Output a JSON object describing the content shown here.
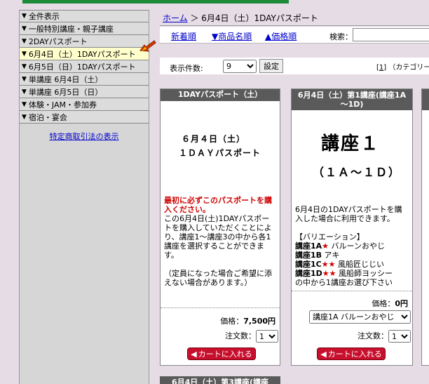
{
  "sidebar": {
    "categories": [
      {
        "label": "全件表示"
      },
      {
        "label": "一般特別講座・親子講座"
      },
      {
        "label": "2DAYパスポート"
      },
      {
        "label": "6月4日（土）1DAYパスポート"
      },
      {
        "label": "6月5日（日）1DAYパスポート"
      },
      {
        "label": "単講座 6月4日（土）"
      },
      {
        "label": "単講座 6月5日（日）"
      },
      {
        "label": "体験・JAM・参加券"
      },
      {
        "label": "宿泊・宴会"
      }
    ],
    "tokutei_link": "特定商取引法の表示"
  },
  "breadcrumb": {
    "home": "ホーム",
    "sep": " ＞ ",
    "current": "6月4日（土）1DAYパスポート"
  },
  "sortbar": {
    "newest": "新着順",
    "name": "▼商品名順",
    "price": "▲価格順",
    "search_label": "検索：",
    "search_value": ""
  },
  "countbar": {
    "label": "表示件数:",
    "selected": "9",
    "set_button": "設定",
    "page_num": "1",
    "page_text": "（カテゴリー内の"
  },
  "products": [
    {
      "header": "1DAYパスポート（土）",
      "image_line1": "６月４日（土）",
      "image_line2": "１ＤＡＹパスポート",
      "desc_red": "最初に必ずこのパスポートを購入ください。",
      "desc": "この6月4日(土)1DAYパスポートを購入していただくことにより、講座1～講座3の中から各1講座を選択することができます。",
      "desc2": "（定員になった場合ご希望に添えない場合があります。）",
      "price_label": "価格：",
      "price": "7,500円",
      "qty_label": "注文数：",
      "qty": "1",
      "cart_button": "カートに入れる"
    },
    {
      "header": "6月4日（土）第1講座(講座1A～1D)",
      "image_line1": "講座１",
      "image_line2": "（１Ａ～１Ｄ）",
      "desc": "6月4日の1DAYパスポートを購入した場合に利用できます。",
      "variation_title": "【バリエーション】",
      "variations": [
        {
          "code": "講座1A",
          "stars": "★",
          "name": "バルーンおやじ"
        },
        {
          "code": "講座1B",
          "stars": "",
          "name": "アキ"
        },
        {
          "code": "講座1C",
          "stars": "★★",
          "name": "風船匠じじい"
        },
        {
          "code": "講座1D",
          "stars": "★★",
          "name": "風船師ヨッシー"
        }
      ],
      "variation_tail": "の中から1講座お選び下さい",
      "price_label": "価格：",
      "price": "0円",
      "option_selected": "講座1A バルーンおやじ",
      "qty_label": "注文数：",
      "qty": "1",
      "cart_button": "カートに入れる"
    }
  ],
  "next_card_header": "6月4日（土）第3講座(講座",
  "colors": {
    "header_bg": "#5a5a5a",
    "accent_red": "#d00000",
    "cart_red": "#c8102e",
    "link": "#0000cc",
    "active_cat": "#ffffcc"
  }
}
